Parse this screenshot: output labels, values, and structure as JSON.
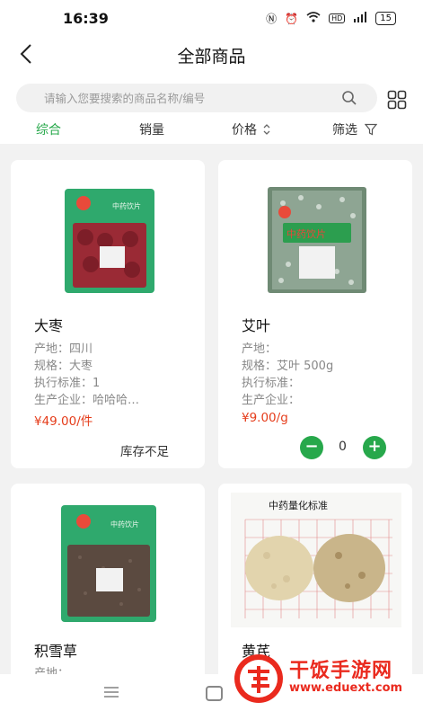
{
  "status_bar": {
    "time": "16:39",
    "network": "HD",
    "battery": "15"
  },
  "header": {
    "title": "全部商品"
  },
  "search": {
    "placeholder": "请输入您要搜索的商品名称/编号"
  },
  "filters": {
    "comprehensive": "综合",
    "sales": "销量",
    "price": "价格",
    "filter": "筛选"
  },
  "products": [
    {
      "name": "大枣",
      "origin": "产地：四川",
      "spec": "规格：大枣",
      "standard": "执行标准：1",
      "company": "生产企业：哈哈哈…",
      "price": "¥49.00/件",
      "stock_text": "库存不足",
      "image_label": "中药饮片"
    },
    {
      "name": "艾叶",
      "origin": "产地：",
      "spec": "规格：艾叶 500g",
      "standard": "执行标准：",
      "company": "生产企业：",
      "price": "¥9.00/g",
      "quantity": "0",
      "image_label": "中药饮片"
    },
    {
      "name": "积雪草",
      "origin": "产地：",
      "image_label": "中药饮片"
    },
    {
      "name": "黄芪",
      "image_label": "中药量化标准"
    }
  ],
  "watermark": {
    "title": "干饭手游网",
    "url": "www.eduext.com"
  },
  "colors": {
    "accent": "#27a84b",
    "price": "#e53c1a",
    "watermark": "#ea2a1e"
  }
}
